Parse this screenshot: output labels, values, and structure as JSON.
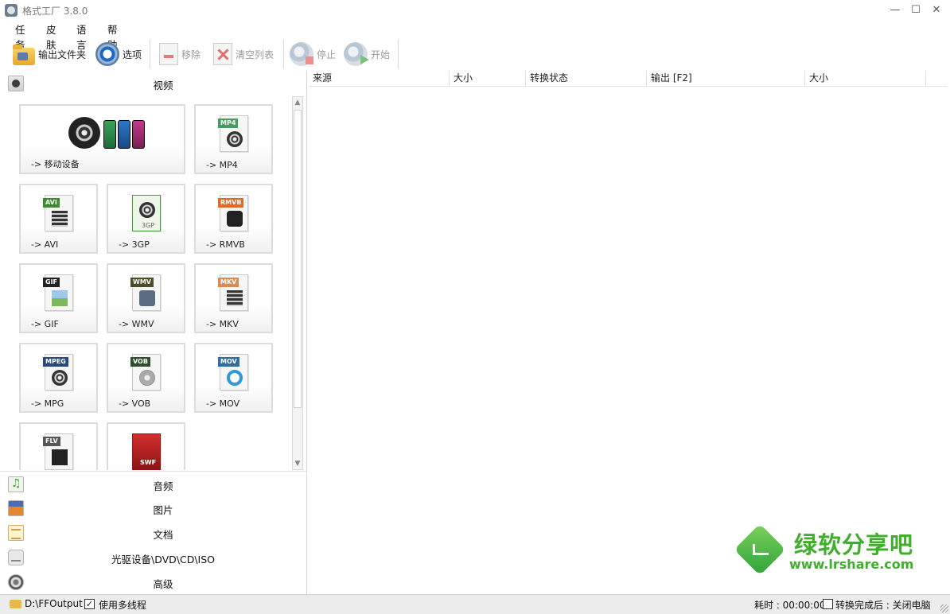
{
  "window": {
    "title": "格式工厂 3.8.0",
    "min": "—",
    "max": "☐",
    "close": "✕"
  },
  "menu": [
    "任务",
    "皮肤",
    "语言",
    "帮助"
  ],
  "toolbar": {
    "output_folder": "输出文件夹",
    "options": "选项",
    "remove": "移除",
    "clear_list": "清空列表",
    "stop": "停止",
    "start": "开始"
  },
  "categories": {
    "video": "视频",
    "audio": "音频",
    "image": "图片",
    "document": "文档",
    "disc": "光驱设备\\DVD\\CD\\ISO",
    "advanced": "高级"
  },
  "video_tiles": [
    {
      "label": "-> 移动设备"
    },
    {
      "label": "-> MP4",
      "badge": "MP4",
      "badge_color": "#4b9a62"
    },
    {
      "label": "-> AVI",
      "badge": "AVI",
      "badge_color": "#3d8d2e"
    },
    {
      "label": "-> 3GP",
      "badge": "3GP",
      "badge_color": "#4a9b3c"
    },
    {
      "label": "-> RMVB",
      "badge": "RMVB",
      "badge_color": "#e06a2a"
    },
    {
      "label": "-> GIF",
      "badge": "GIF",
      "badge_color": "#222222"
    },
    {
      "label": "-> WMV",
      "badge": "WMV",
      "badge_color": "#4d4d2a"
    },
    {
      "label": "-> MKV",
      "badge": "MKV",
      "badge_color": "#d88a55"
    },
    {
      "label": "-> MPG",
      "badge": "MPEG",
      "badge_color": "#254a80"
    },
    {
      "label": "-> VOB",
      "badge": "VOB",
      "badge_color": "#2d4f2d"
    },
    {
      "label": "-> MOV",
      "badge": "MOV",
      "badge_color": "#2d6fa0"
    },
    {
      "label": "",
      "badge": "FLV",
      "badge_color": "#555555"
    },
    {
      "label": "",
      "badge": "SWF",
      "badge_color": "#b71c1c"
    }
  ],
  "list_columns": [
    "来源",
    "大小",
    "转换状态",
    "输出 [F2]",
    "大小"
  ],
  "watermark": {
    "cn": "绿软分享吧",
    "url": "www.lrshare.com"
  },
  "status": {
    "output_path": "D:\\FFOutput",
    "multithread_label": "使用多线程",
    "multithread_checked": "✓",
    "elapsed": "耗时 : 00:00:00",
    "after_done": "转换完成后 : 关闭电脑"
  },
  "colors": {
    "accent_green": "#3fae2a"
  }
}
